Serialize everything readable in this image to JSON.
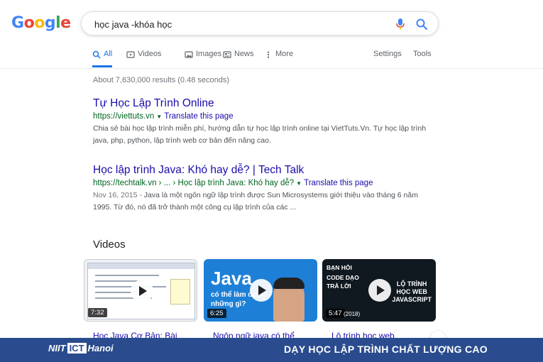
{
  "logo": {
    "text": "Google",
    "letters": [
      "G",
      "o",
      "o",
      "g",
      "l",
      "e"
    ]
  },
  "search": {
    "value": "học java -khóa học"
  },
  "tabs": [
    {
      "label": "All",
      "icon": "search-icon",
      "active": true
    },
    {
      "label": "Videos",
      "icon": "video-icon"
    },
    {
      "label": "Images",
      "icon": "image-icon"
    },
    {
      "label": "News",
      "icon": "news-icon"
    },
    {
      "label": "More",
      "icon": "more-vert-icon"
    },
    {
      "label": "Settings"
    },
    {
      "label": "Tools"
    }
  ],
  "stats": "About 7,630,000 results (0.48 seconds)",
  "results": [
    {
      "title": "Tự Học Lập Trình Online",
      "url": "https://viettuts.vn",
      "translate": "Translate this page",
      "snippet": "Chia sẻ bài học lập trình miễn phí, hướng dẫn tự học lập trình online tại VietTuts.Vn. Tự học lập trình java, php, python, lập trình web cơ bản đến nâng cao."
    },
    {
      "title": "Học lập trình Java: Khó hay dễ? | Tech Talk",
      "url": "https://techtalk.vn › ... › Học lập trình Java: Khó hay dễ?",
      "translate": "Translate this page",
      "date": "Nov 16, 2015 - ",
      "snippet": "Java là một ngôn ngữ lập trình được Sun Microsystems giới thiệu vào tháng 6 năm 1995. Từ đó, nó đã trở thành một công cụ lập trình của các ..."
    }
  ],
  "videos": {
    "heading": "Videos",
    "items": [
      {
        "duration": "7:32",
        "caption": "Học Java Cơ Bản: Bài"
      },
      {
        "duration": "6:25",
        "caption": "Ngôn ngữ java có thể",
        "overlay_big": "Java",
        "overlay_sub": [
          "có thể làm được",
          "những gì?"
        ]
      },
      {
        "duration": "5:47",
        "caption": "Lộ trình học web",
        "overlay_left": [
          "BẠN HỎI",
          "CODE DẠO",
          "TRẢ LỜI"
        ],
        "overlay_right": [
          "LỘ TRÌNH",
          "HỌC WEB",
          "JAVASCRIPT"
        ],
        "overlay_year": "(2018)"
      }
    ]
  },
  "footer": {
    "brand_left": "NIIT",
    "brand_box": "ICT",
    "brand_right": "Hanoi",
    "slogan": "DẠY HỌC LẬP TRÌNH CHẤT LƯỢNG CAO"
  },
  "colors": {
    "link": "#1a0dab",
    "url": "#006621",
    "accent": "#1a73e8",
    "footer": "#2a4c8e"
  }
}
